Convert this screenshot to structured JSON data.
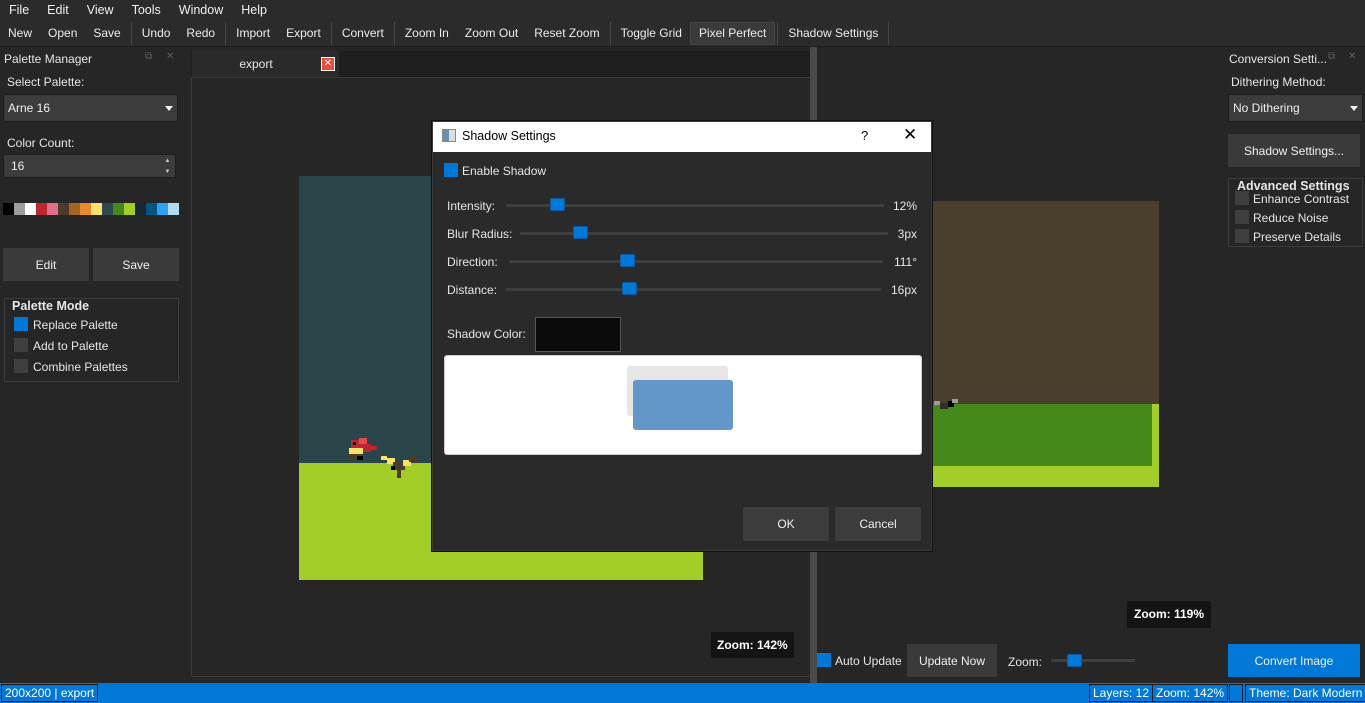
{
  "menu": [
    "File",
    "Edit",
    "View",
    "Tools",
    "Window",
    "Help"
  ],
  "toolbar": {
    "new": "New",
    "open": "Open",
    "save": "Save",
    "undo": "Undo",
    "redo": "Redo",
    "import": "Import",
    "export": "Export",
    "convert": "Convert",
    "zoom_in": "Zoom In",
    "zoom_out": "Zoom Out",
    "reset_zoom": "Reset Zoom",
    "toggle_grid": "Toggle Grid",
    "pixel_perfect": "Pixel Perfect",
    "shadow_settings": "Shadow Settings"
  },
  "palette_manager": {
    "title": "Palette Manager",
    "select_palette_label": "Select Palette:",
    "selected_palette": "Arne 16",
    "color_count_label": "Color Count:",
    "color_count": "16",
    "swatches": [
      "#000000",
      "#9d9d9d",
      "#ffffff",
      "#be2633",
      "#e06f8b",
      "#493c2b",
      "#a46422",
      "#eb8931",
      "#f7e26b",
      "#2f484e",
      "#44891a",
      "#a3ce27",
      "#1b2632",
      "#005784",
      "#31a2f2",
      "#b2dcef"
    ],
    "edit_button": "Edit",
    "save_button": "Save",
    "mode_title": "Palette Mode",
    "modes": [
      {
        "label": "Replace Palette",
        "checked": true
      },
      {
        "label": "Add to Palette",
        "checked": false
      },
      {
        "label": "Combine Palettes",
        "checked": false
      }
    ]
  },
  "editor": {
    "tab_label": "export",
    "zoom_label": "Zoom: 142%"
  },
  "preview": {
    "zoom_label": "Zoom: 119%",
    "auto_update_label": "Auto Update",
    "auto_update_checked": true,
    "update_now_button": "Update Now",
    "zoom_slider_label": "Zoom:"
  },
  "conversion_settings": {
    "title": "Conversion Setti...",
    "dithering_label": "Dithering Method:",
    "dithering_value": "No Dithering",
    "shadow_button": "Shadow Settings...",
    "advanced_title": "Advanced Settings",
    "advanced": [
      {
        "label": "Enhance Contrast",
        "checked": false
      },
      {
        "label": "Reduce Noise",
        "checked": false
      },
      {
        "label": "Preserve Details",
        "checked": false
      }
    ],
    "convert_button": "Convert Image"
  },
  "dialog": {
    "title": "Shadow Settings",
    "help": "?",
    "enable_label": "Enable Shadow",
    "enable_checked": true,
    "sliders": [
      {
        "label": "Intensity:",
        "value": "12%",
        "fraction": 0.13
      },
      {
        "label": "Blur Radius:",
        "value": "3px",
        "fraction": 0.17
      },
      {
        "label": "Direction:",
        "value": "111°",
        "fraction": 0.32
      },
      {
        "label": "Distance:",
        "value": "16px",
        "fraction": 0.33
      }
    ],
    "shadow_color_label": "Shadow Color:",
    "shadow_color": "#0b0b0b",
    "ok_button": "OK",
    "cancel_button": "Cancel"
  },
  "status": {
    "left": "200x200 | export",
    "layers": "Layers: 12",
    "zoom": "Zoom: 142%",
    "theme": "Theme: Dark Modern"
  },
  "colors": {
    "accent": "#0078d7",
    "sky": "#2b464b",
    "grass": "#a3cd29",
    "preview_dirt": "#4a3f2d",
    "preview_grass": "#44891a"
  }
}
